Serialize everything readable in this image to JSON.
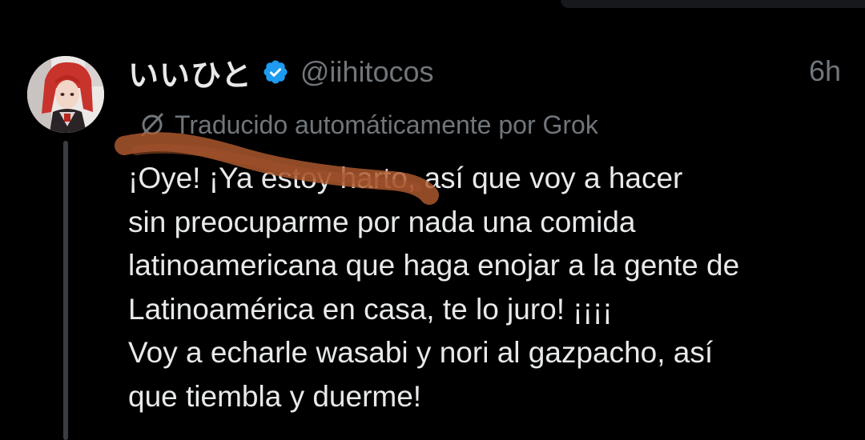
{
  "tweet": {
    "display_name": "いいひと",
    "handle": "@iihitocos",
    "time": "6h",
    "translation_label": "Traducido automáticamente por Grok",
    "text_lines": [
      "¡Oye! ¡Ya estoy harto, así que voy a hacer",
      "sin preocuparme por nada una comida",
      "latinoamericana que haga enojar a la gente de",
      "Latinoamérica en casa, te lo juro! ¡¡¡¡",
      "Voy a echarle wasabi y nori al gazpacho, así",
      "que tiembla y duerme!"
    ]
  },
  "icons": {
    "verified": "verified-badge-icon",
    "translate": "grok-translate-icon",
    "avatar": "user-avatar"
  },
  "colors": {
    "background": "#000000",
    "primary_text": "#e7e9ea",
    "secondary_text": "#71767b",
    "verified_blue": "#1d9bf0",
    "thread_line": "#3a3d41",
    "annotation_stroke": "#b05a2e"
  }
}
